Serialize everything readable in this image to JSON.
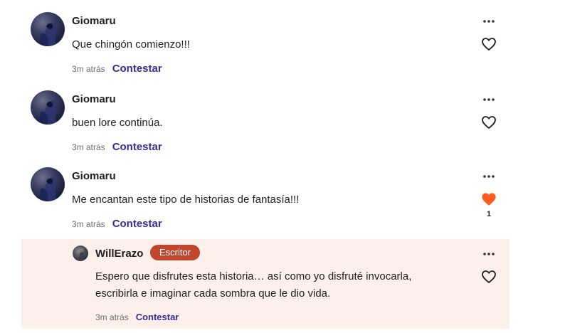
{
  "comments": [
    {
      "author": "Giomaru",
      "text": "Que chingón comienzo!!!",
      "time": "3m atrás",
      "reply_label": "Contestar",
      "liked": false,
      "like_count": ""
    },
    {
      "author": "Giomaru",
      "text": "buen lore continúa.",
      "time": "3m atrás",
      "reply_label": "Contestar",
      "liked": false,
      "like_count": ""
    },
    {
      "author": "Giomaru",
      "text": "Me encantan este tipo de historias de fantasía!!!",
      "time": "3m atrás",
      "reply_label": "Contestar",
      "liked": true,
      "like_count": "1"
    }
  ],
  "reply": {
    "author": "WillErazo",
    "badge": "Escritor",
    "text": "Espero que disfrutes esta historia… así como yo disfruté invocarla, escribirla e imaginar cada sombra que le dio vida.",
    "time": "3m atrás",
    "reply_label": "Contestar"
  },
  "colors": {
    "link": "#3a2b97",
    "badge": "#c0462d",
    "liked_heart": "#ff5a1f",
    "reply_background": "#fdf0ea"
  },
  "icons": {
    "more": "more-options-icon",
    "like": "heart-icon"
  }
}
